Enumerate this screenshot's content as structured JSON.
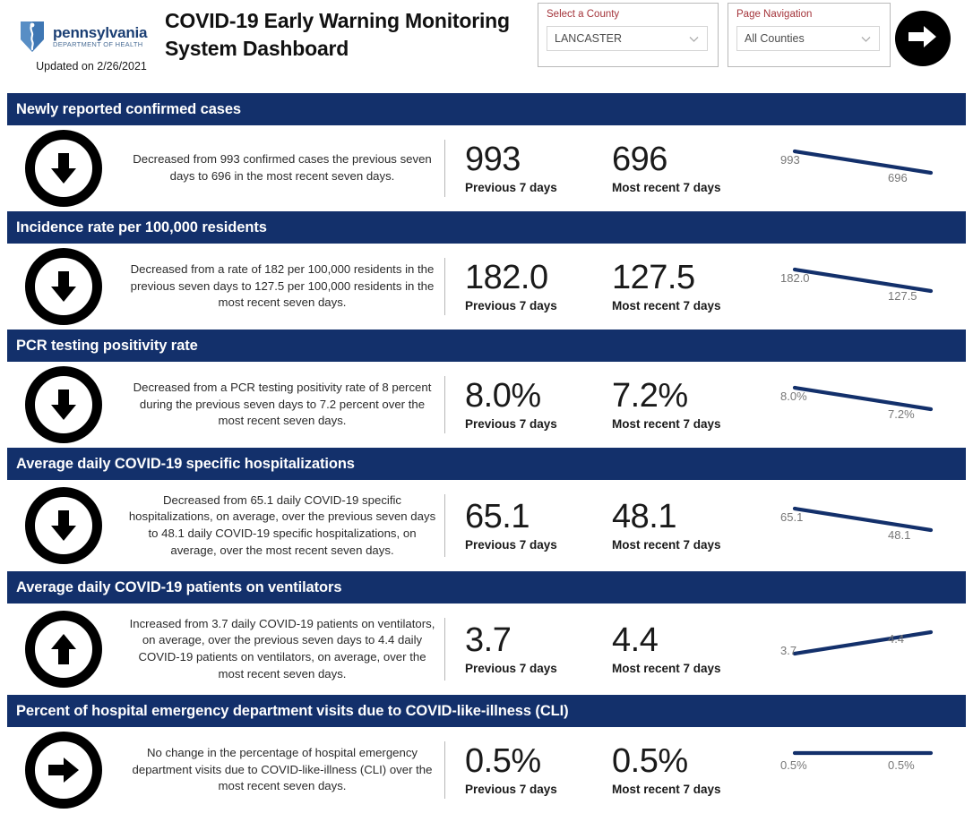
{
  "header": {
    "logo_title": "pennsylvania",
    "logo_subtitle": "DEPARTMENT OF HEALTH",
    "logo_icon": "pa-keystone-icon",
    "updated": "Updated on 2/26/2021",
    "dashboard_title": "COVID-19 Early Warning Monitoring System Dashboard",
    "county_slicer": {
      "title": "Select a County",
      "value": "LANCASTER",
      "chevron_icon": "chevron-down-icon"
    },
    "page_nav_slicer": {
      "title": "Page Navigation",
      "value": "All Counties",
      "chevron_icon": "chevron-down-icon"
    },
    "next_button_icon": "arrow-right-icon",
    "accent_red": "#a4343a",
    "brand_navy": "#13306b"
  },
  "labels": {
    "previous": "Previous 7 days",
    "recent": "Most recent 7 days"
  },
  "sections": [
    {
      "title": "Newly reported confirmed cases",
      "trend": "down",
      "trend_icon": "arrow-down-circle-icon",
      "description": "Decreased from 993 confirmed cases the previous seven days to 696 in the most recent seven days.",
      "previous_value": "993",
      "recent_value": "696",
      "spark_left_label": "993",
      "spark_right_label": "696"
    },
    {
      "title": "Incidence rate per 100,000 residents",
      "trend": "down",
      "trend_icon": "arrow-down-circle-icon",
      "description": "Decreased from a rate of 182 per 100,000 residents in the previous seven days to 127.5 per 100,000 residents in the most recent seven days.",
      "previous_value": "182.0",
      "recent_value": "127.5",
      "spark_left_label": "182.0",
      "spark_right_label": "127.5"
    },
    {
      "title": "PCR testing positivity rate",
      "trend": "down",
      "trend_icon": "arrow-down-circle-icon",
      "description": "Decreased from a PCR testing positivity rate of 8 percent during the previous seven days to 7.2 percent over the most recent seven days.",
      "previous_value": "8.0%",
      "recent_value": "7.2%",
      "spark_left_label": "8.0%",
      "spark_right_label": "7.2%"
    },
    {
      "title": "Average daily COVID-19 specific hospitalizations",
      "trend": "down",
      "trend_icon": "arrow-down-circle-icon",
      "description": "Decreased from 65.1 daily COVID-19 specific hospitalizations, on average, over the previous seven days to 48.1 daily COVID-19 specific hospitalizations, on average, over the most recent seven days.",
      "previous_value": "65.1",
      "recent_value": "48.1",
      "spark_left_label": "65.1",
      "spark_right_label": "48.1"
    },
    {
      "title": "Average daily COVID-19 patients on ventilators",
      "trend": "up",
      "trend_icon": "arrow-up-circle-icon",
      "description": "Increased from 3.7 daily COVID-19 patients on ventilators, on average, over the previous seven days to 4.4 daily COVID-19 patients on ventilators, on average, over the most recent seven days.",
      "previous_value": "3.7",
      "recent_value": "4.4",
      "spark_left_label": "3.7",
      "spark_right_label": "4.4"
    },
    {
      "title": "Percent of hospital emergency department visits due to COVID-like-illness (CLI)",
      "trend": "flat",
      "trend_icon": "arrow-right-circle-icon",
      "description": "No change in the percentage of hospital emergency department visits due to COVID-like-illness (CLI) over the most recent seven days.",
      "previous_value": "0.5%",
      "recent_value": "0.5%",
      "spark_left_label": "0.5%",
      "spark_right_label": "0.5%"
    }
  ],
  "chart_data": [
    {
      "type": "line",
      "title": "Newly reported confirmed cases",
      "categories": [
        "Previous 7 days",
        "Most recent 7 days"
      ],
      "values": [
        993,
        696
      ],
      "xlabel": "",
      "ylabel": "",
      "grid": false,
      "legend": "none",
      "line_color": "#13306b"
    },
    {
      "type": "line",
      "title": "Incidence rate per 100,000 residents",
      "categories": [
        "Previous 7 days",
        "Most recent 7 days"
      ],
      "values": [
        182.0,
        127.5
      ],
      "xlabel": "",
      "ylabel": "",
      "grid": false,
      "legend": "none",
      "line_color": "#13306b"
    },
    {
      "type": "line",
      "title": "PCR testing positivity rate",
      "categories": [
        "Previous 7 days",
        "Most recent 7 days"
      ],
      "values": [
        8.0,
        7.2
      ],
      "xlabel": "",
      "ylabel": "",
      "grid": false,
      "legend": "none",
      "line_color": "#13306b"
    },
    {
      "type": "line",
      "title": "Average daily COVID-19 specific hospitalizations",
      "categories": [
        "Previous 7 days",
        "Most recent 7 days"
      ],
      "values": [
        65.1,
        48.1
      ],
      "xlabel": "",
      "ylabel": "",
      "grid": false,
      "legend": "none",
      "line_color": "#13306b"
    },
    {
      "type": "line",
      "title": "Average daily COVID-19 patients on ventilators",
      "categories": [
        "Previous 7 days",
        "Most recent 7 days"
      ],
      "values": [
        3.7,
        4.4
      ],
      "xlabel": "",
      "ylabel": "",
      "grid": false,
      "legend": "none",
      "line_color": "#13306b"
    },
    {
      "type": "line",
      "title": "Percent of hospital emergency department visits due to COVID-like-illness (CLI)",
      "categories": [
        "Previous 7 days",
        "Most recent 7 days"
      ],
      "values": [
        0.5,
        0.5
      ],
      "xlabel": "",
      "ylabel": "",
      "grid": false,
      "legend": "none",
      "line_color": "#13306b"
    }
  ]
}
